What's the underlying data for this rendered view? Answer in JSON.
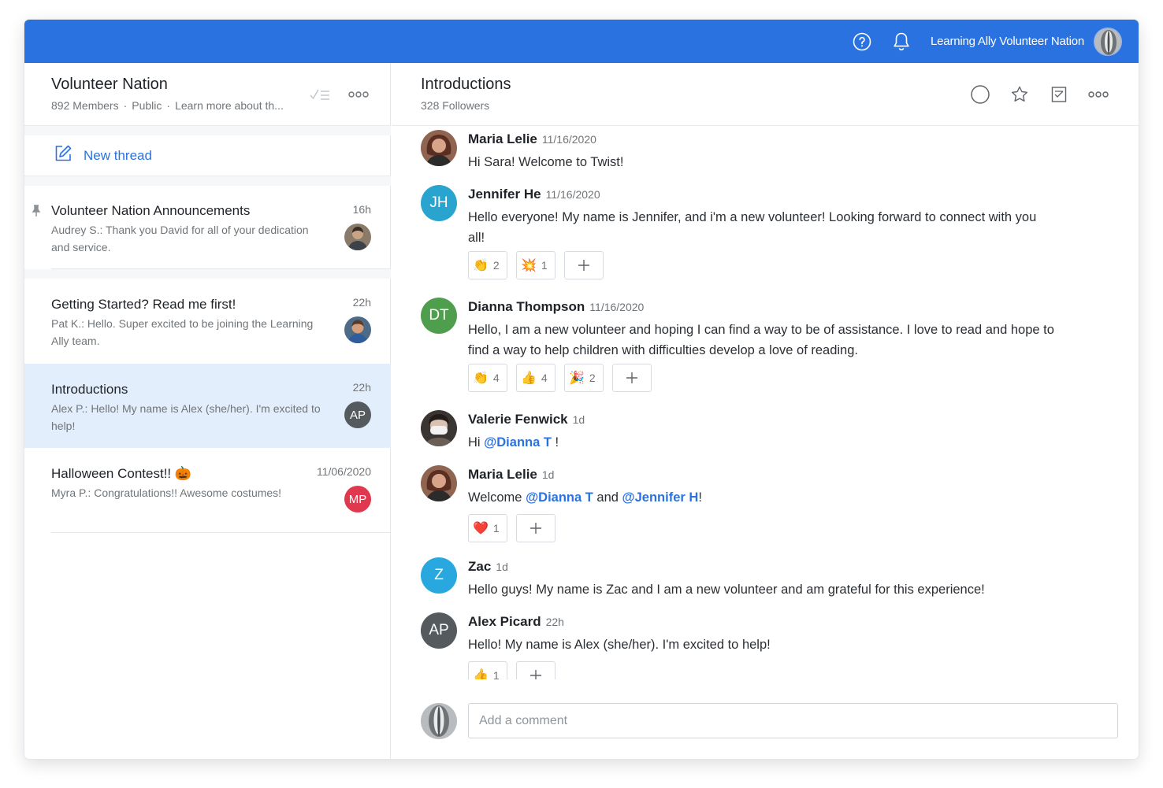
{
  "topbar": {
    "workspace_name": "Learning Ally Volunteer Nation",
    "help_icon": "help-circle-icon",
    "bell_icon": "bell-icon",
    "accent_color": "#2a72e0"
  },
  "channel": {
    "title": "Volunteer Nation",
    "members": "892 Members",
    "visibility": "Public",
    "description": "Learn more about th..."
  },
  "new_thread": {
    "label": "New thread"
  },
  "threads": [
    {
      "title": "Volunteer Nation Announcements",
      "time": "16h",
      "snippet": "Audrey S.: Thank you David for all of your dedication and service.",
      "pinned": true,
      "avatar": "photo"
    },
    {
      "title": "Getting Started? Read me first!",
      "time": "22h",
      "snippet": "Pat K.: Hello. Super excited to be joining the Learning Ally team.",
      "avatar": "photo"
    },
    {
      "title": "Introductions",
      "time": "22h",
      "snippet": "Alex P.: Hello! My name is Alex (she/her). I'm excited to help!",
      "avatar_initials": "AP",
      "avatar_color": "#555a5f",
      "active": true
    },
    {
      "title": "Halloween Contest!!",
      "title_emoji": "🎃",
      "time": "11/06/2020",
      "snippet": "Myra P.: Congratulations!! Awesome costumes!",
      "avatar_initials": "MP",
      "avatar_color": "#e0394f"
    }
  ],
  "thread_view": {
    "title": "Introductions",
    "followers": "328 Followers"
  },
  "messages": [
    {
      "name": "Maria Lelie",
      "time": "11/16/2020",
      "avatar": "photo",
      "text": "Hi Sara! Welcome to Twist!"
    },
    {
      "name": "Jennifer He",
      "time": "11/16/2020",
      "avatar_initials": "JH",
      "avatar_color": "#28a4cf",
      "text": "Hello everyone! My name is Jennifer, and i'm a new volunteer! Looking forward to connect with you all!",
      "reactions": [
        {
          "emoji": "👏",
          "count": "2"
        },
        {
          "emoji": "💥",
          "count": "1"
        }
      ]
    },
    {
      "name": "Dianna Thompson",
      "time": "11/16/2020",
      "avatar_initials": "DT",
      "avatar_color": "#4f9e4d",
      "text": "Hello, I am a new volunteer and hoping I can find a way to be of assistance. I love to read and hope to find a way to help children with difficulties develop a love of reading.",
      "reactions": [
        {
          "emoji": "👏",
          "count": "4"
        },
        {
          "emoji": "👍",
          "count": "4"
        },
        {
          "emoji": "🎉",
          "count": "2"
        }
      ]
    },
    {
      "name": "Valerie Fenwick",
      "time": "1d",
      "avatar": "photo",
      "text_prefix": "Hi ",
      "mention1": "@Dianna T",
      "text_suffix": " !"
    },
    {
      "name": "Maria Lelie",
      "time": "1d",
      "avatar": "photo",
      "text_prefix": "Welcome ",
      "mention1": "@Dianna T",
      "text_mid": " and ",
      "mention2": "@Jennifer H",
      "text_suffix": "!",
      "reactions": [
        {
          "emoji": "❤️",
          "count": "1"
        }
      ]
    },
    {
      "name": "Zac",
      "time": "1d",
      "avatar_initials": "Z",
      "avatar_color": "#29a8e0",
      "text": "Hello guys! My name is Zac and I am a new volunteer and am grateful for this experience!"
    },
    {
      "name": "Alex Picard",
      "time": "22h",
      "avatar_initials": "AP",
      "avatar_color": "#555a5f",
      "text": "Hello! My name is Alex (she/her). I'm excited to help!",
      "reactions": [
        {
          "emoji": "👍",
          "count": "1"
        }
      ]
    }
  ],
  "composer": {
    "placeholder": "Add a comment"
  }
}
